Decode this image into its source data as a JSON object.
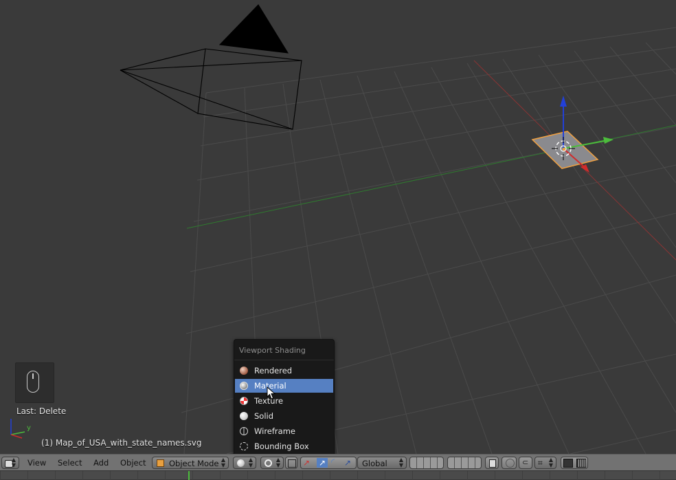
{
  "viewport": {
    "last_operator": "Last: Delete",
    "object_name": "(1) Map_of_USA_with_state_names.svg",
    "axis_y_label": "y"
  },
  "shading_menu": {
    "title": "Viewport Shading",
    "items": [
      {
        "label": "Rendered",
        "icon": "rendered-icon",
        "active": false
      },
      {
        "label": "Material",
        "icon": "material-icon",
        "active": true
      },
      {
        "label": "Texture",
        "icon": "texture-icon",
        "active": false
      },
      {
        "label": "Solid",
        "icon": "solid-icon",
        "active": false
      },
      {
        "label": "Wireframe",
        "icon": "wireframe-icon",
        "active": false
      },
      {
        "label": "Bounding Box",
        "icon": "bounding-box-icon",
        "active": false
      }
    ]
  },
  "header": {
    "menus": [
      "View",
      "Select",
      "Add",
      "Object"
    ],
    "mode": "Object Mode",
    "orientation": "Global"
  },
  "colors": {
    "menu_highlight": "#5680c2",
    "x_axis": "#d12b2b",
    "y_axis": "#4cbc3c",
    "z_axis": "#2240d8",
    "selected_outline": "#f0a040"
  }
}
